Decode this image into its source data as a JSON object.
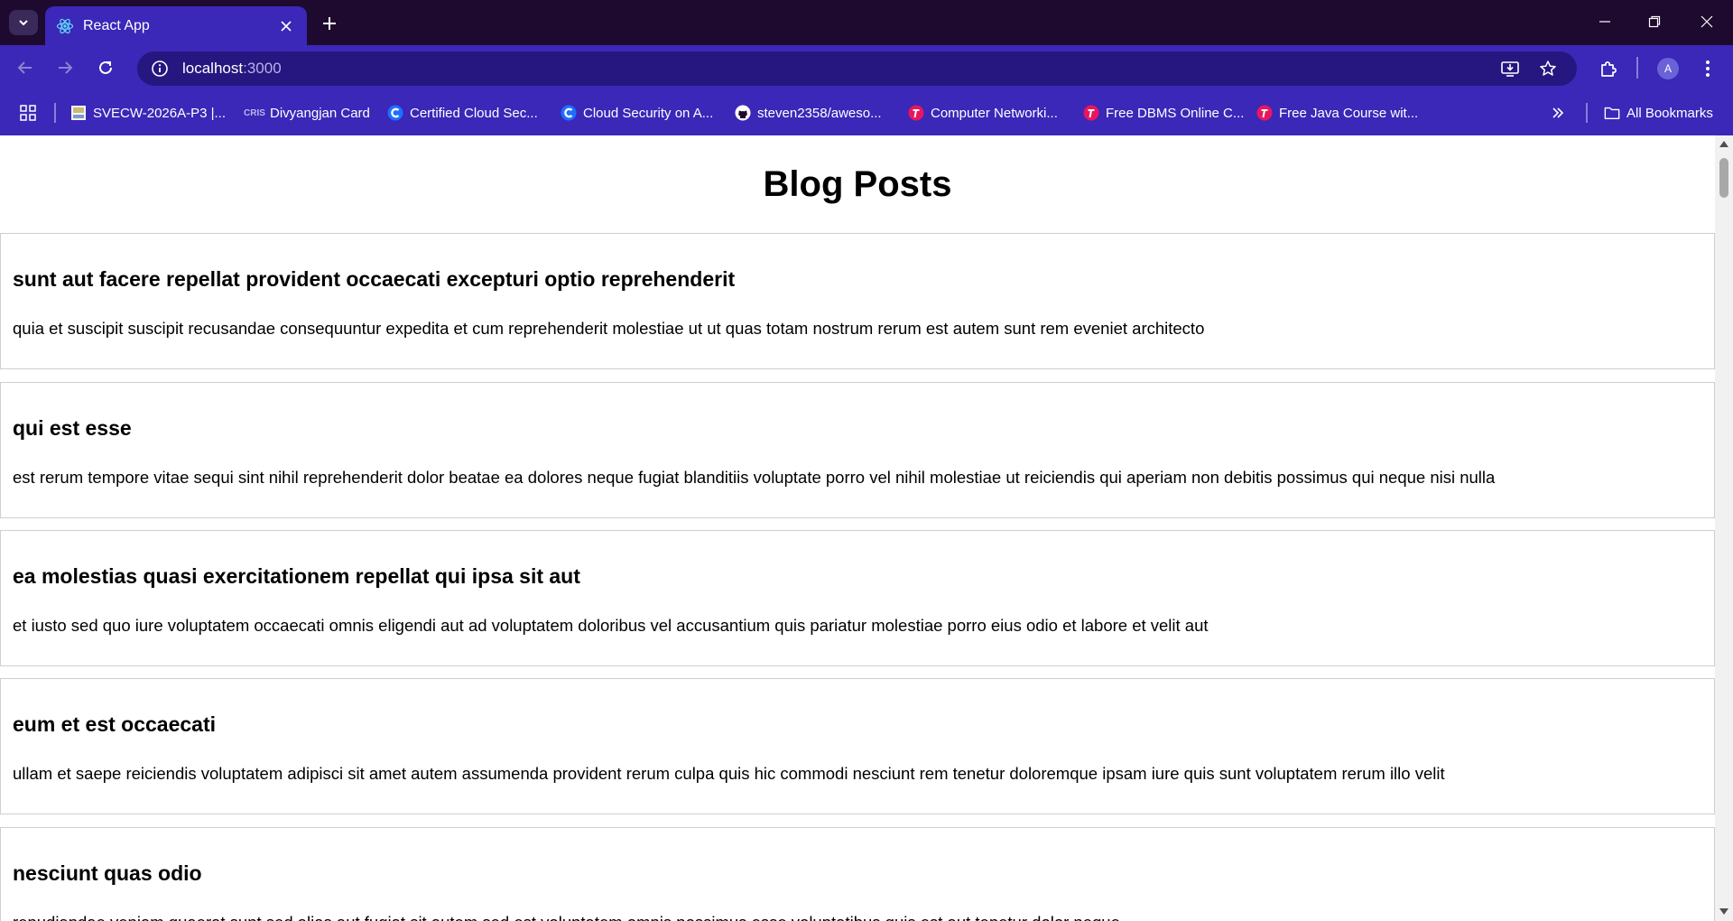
{
  "browser": {
    "tab_title": "React App",
    "url_host": "localhost",
    "url_port": ":3000",
    "avatar_initial": "A",
    "colors": {
      "tab_strip": "#1e0a2e",
      "toolbar": "#3b27b8",
      "omnibox": "#261680"
    }
  },
  "bookmarks": {
    "items": [
      {
        "label": "SVECW-2026A-P3 |...",
        "icon": "page-icon"
      },
      {
        "label": "Divyangjan Card",
        "icon": "cris-icon"
      },
      {
        "label": "Certified Cloud Sec...",
        "icon": "c-logo-icon"
      },
      {
        "label": "Cloud Security on A...",
        "icon": "c-logo-icon"
      },
      {
        "label": "steven2358/aweso...",
        "icon": "github-icon"
      },
      {
        "label": "Computer Networki...",
        "icon": "t-logo-icon"
      },
      {
        "label": "Free DBMS Online C...",
        "icon": "t-logo-icon"
      },
      {
        "label": "Free Java Course wit...",
        "icon": "t-logo-icon"
      }
    ],
    "all_bookmarks": "All Bookmarks"
  },
  "page": {
    "heading": "Blog Posts",
    "posts": [
      {
        "title": "sunt aut facere repellat provident occaecati excepturi optio reprehenderit",
        "body": "quia et suscipit suscipit recusandae consequuntur expedita et cum reprehenderit molestiae ut ut quas totam nostrum rerum est autem sunt rem eveniet architecto"
      },
      {
        "title": "qui est esse",
        "body": "est rerum tempore vitae sequi sint nihil reprehenderit dolor beatae ea dolores neque fugiat blanditiis voluptate porro vel nihil molestiae ut reiciendis qui aperiam non debitis possimus qui neque nisi nulla"
      },
      {
        "title": "ea molestias quasi exercitationem repellat qui ipsa sit aut",
        "body": "et iusto sed quo iure voluptatem occaecati omnis eligendi aut ad voluptatem doloribus vel accusantium quis pariatur molestiae porro eius odio et labore et velit aut"
      },
      {
        "title": "eum et est occaecati",
        "body": "ullam et saepe reiciendis voluptatem adipisci sit amet autem assumenda provident rerum culpa quis hic commodi nesciunt rem tenetur doloremque ipsam iure quis sunt voluptatem rerum illo velit"
      },
      {
        "title": "nesciunt quas odio",
        "body": "repudiandae veniam quaerat sunt sed alias aut fugiat sit autem sed est voluptatem omnis possimus esse voluptatibus quis est aut tenetur dolor neque"
      }
    ]
  }
}
